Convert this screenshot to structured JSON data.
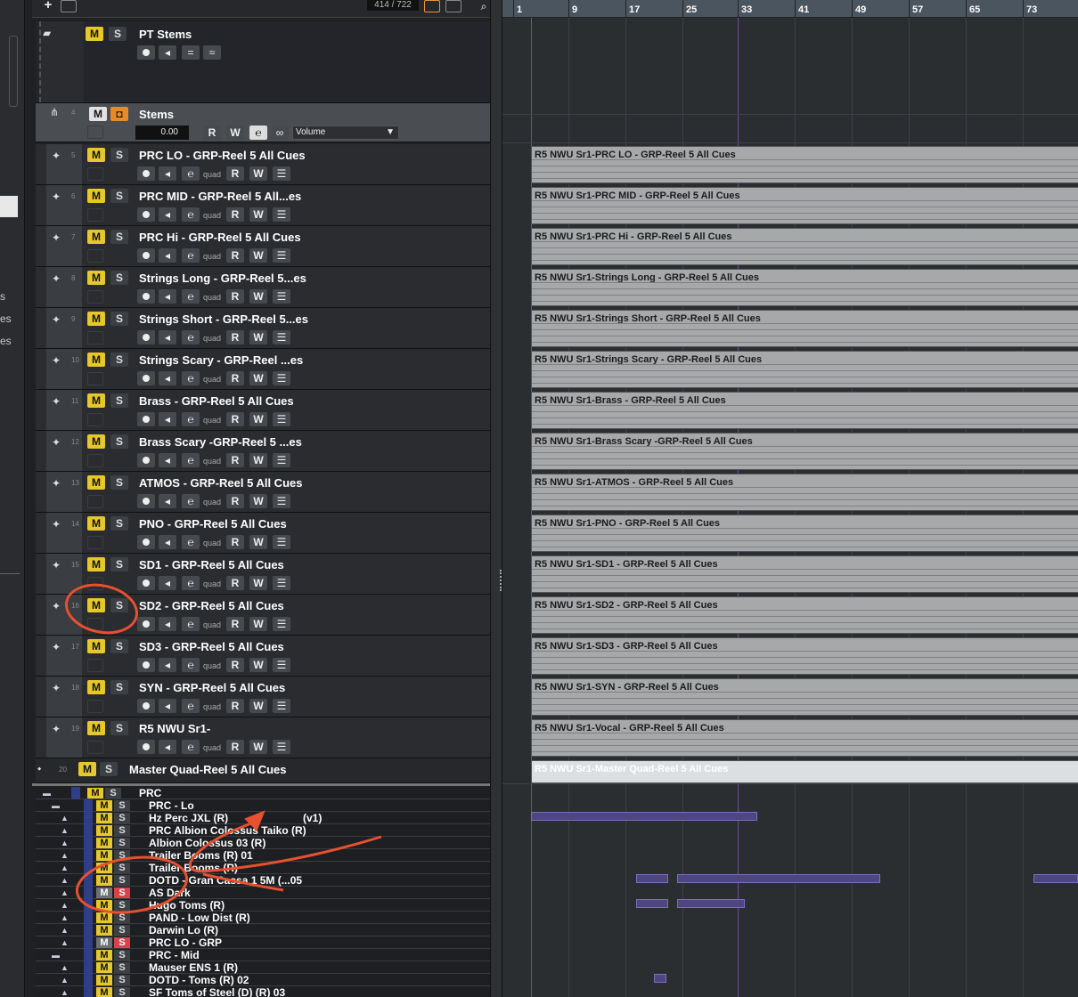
{
  "toolbar": {
    "add_label": "+",
    "track_counter": "414 / 722",
    "search_icon": "search-icon"
  },
  "ruler": {
    "bars": [
      "1",
      "9",
      "17",
      "25",
      "33",
      "41",
      "49",
      "57",
      "65",
      "73"
    ]
  },
  "inspector": {
    "fragments": [
      "s",
      "es",
      "es"
    ]
  },
  "folder_track": {
    "name": "PT Stems",
    "mute": "M",
    "solo": "S"
  },
  "group_track": {
    "number": "4",
    "name": "Stems",
    "mute": "M",
    "value": "0.00",
    "read": "R",
    "write": "W",
    "automation_param": "Volume"
  },
  "audio_tracks": [
    {
      "number": "5",
      "name": "PRC LO - GRP-Reel 5 All Cues",
      "event": "R5 NWU Sr1-PRC LO - GRP-Reel 5 All Cues"
    },
    {
      "number": "6",
      "name": "PRC MID - GRP-Reel 5 All...es",
      "event": "R5 NWU Sr1-PRC MID - GRP-Reel 5 All Cues"
    },
    {
      "number": "7",
      "name": "PRC Hi - GRP-Reel 5 All Cues",
      "event": "R5 NWU Sr1-PRC Hi - GRP-Reel 5 All Cues"
    },
    {
      "number": "8",
      "name": "Strings Long - GRP-Reel 5...es",
      "event": "R5 NWU Sr1-Strings Long - GRP-Reel 5 All Cues"
    },
    {
      "number": "9",
      "name": "Strings Short - GRP-Reel 5...es",
      "event": "R5 NWU Sr1-Strings Short - GRP-Reel 5 All Cues"
    },
    {
      "number": "10",
      "name": "Strings Scary - GRP-Reel ...es",
      "event": "R5 NWU Sr1-Strings Scary - GRP-Reel 5 All Cues"
    },
    {
      "number": "11",
      "name": "Brass - GRP-Reel 5 All Cues",
      "event": "R5 NWU Sr1-Brass - GRP-Reel 5 All Cues"
    },
    {
      "number": "12",
      "name": "Brass Scary -GRP-Reel 5 ...es",
      "event": "R5 NWU Sr1-Brass Scary -GRP-Reel 5 All Cues"
    },
    {
      "number": "13",
      "name": "ATMOS - GRP-Reel 5 All Cues",
      "event": "R5 NWU Sr1-ATMOS - GRP-Reel 5 All Cues"
    },
    {
      "number": "14",
      "name": "PNO - GRP-Reel 5 All Cues",
      "event": "R5 NWU Sr1-PNO - GRP-Reel 5 All Cues"
    },
    {
      "number": "15",
      "name": "SD1 - GRP-Reel 5 All Cues",
      "event": "R5 NWU Sr1-SD1 - GRP-Reel 5 All Cues"
    },
    {
      "number": "16",
      "name": "SD2 - GRP-Reel 5 All Cues",
      "event": "R5 NWU Sr1-SD2 - GRP-Reel 5 All Cues"
    },
    {
      "number": "17",
      "name": "SD3 - GRP-Reel 5 All Cues",
      "event": "R5 NWU Sr1-SD3 - GRP-Reel 5 All Cues"
    },
    {
      "number": "18",
      "name": "SYN - GRP-Reel 5 All Cues",
      "event": "R5 NWU Sr1-SYN - GRP-Reel 5 All Cues"
    },
    {
      "number": "19",
      "name": "R5 NWU Sr1-",
      "event": "R5 NWU Sr1-Vocal - GRP-Reel 5 All Cues"
    }
  ],
  "track_controls": {
    "mute": "M",
    "solo": "S",
    "quad": "quad",
    "read": "R",
    "write": "W"
  },
  "master_track": {
    "number": "20",
    "name": "Master Quad-Reel 5 All Cues",
    "event": "R5 NWU Sr1-Master Quad-Reel 5 All Cues"
  },
  "lower_tracks": [
    {
      "name": "PRC",
      "folder": true
    },
    {
      "name": "PRC - Lo",
      "folder": true
    },
    {
      "name": "Hz Perc JXL (R)",
      "extra": "(v1)"
    },
    {
      "name": "PRC Albion Colossus Taiko (R)"
    },
    {
      "name": "Albion Colossus 03 (R)"
    },
    {
      "name": "Trailer Booms (R) 01"
    },
    {
      "name": "Trailer Booms (R)"
    },
    {
      "name": "DOTD - Gran Cassa 1 5M (...05"
    },
    {
      "name": "AS Dark",
      "muted": true
    },
    {
      "name": "Hugo Toms (R)"
    },
    {
      "name": "PAND - Low Dist (R)"
    },
    {
      "name": "Darwin Lo (R)"
    },
    {
      "name": "PRC LO - GRP",
      "muted": true
    },
    {
      "name": "PRC - Mid",
      "folder": true
    },
    {
      "name": "Mauser ENS 1 (R)"
    },
    {
      "name": "DOTD - Toms (R) 02"
    },
    {
      "name": "SF Toms of Steel (D) (R) 03"
    }
  ],
  "colors": {
    "mute_yellow": "#e6c82d",
    "solo_red": "#d9424a",
    "annotation": "#e8502f",
    "ruler": "#4b5560",
    "event": "#a6a8aa",
    "midi": "#4f4580"
  }
}
